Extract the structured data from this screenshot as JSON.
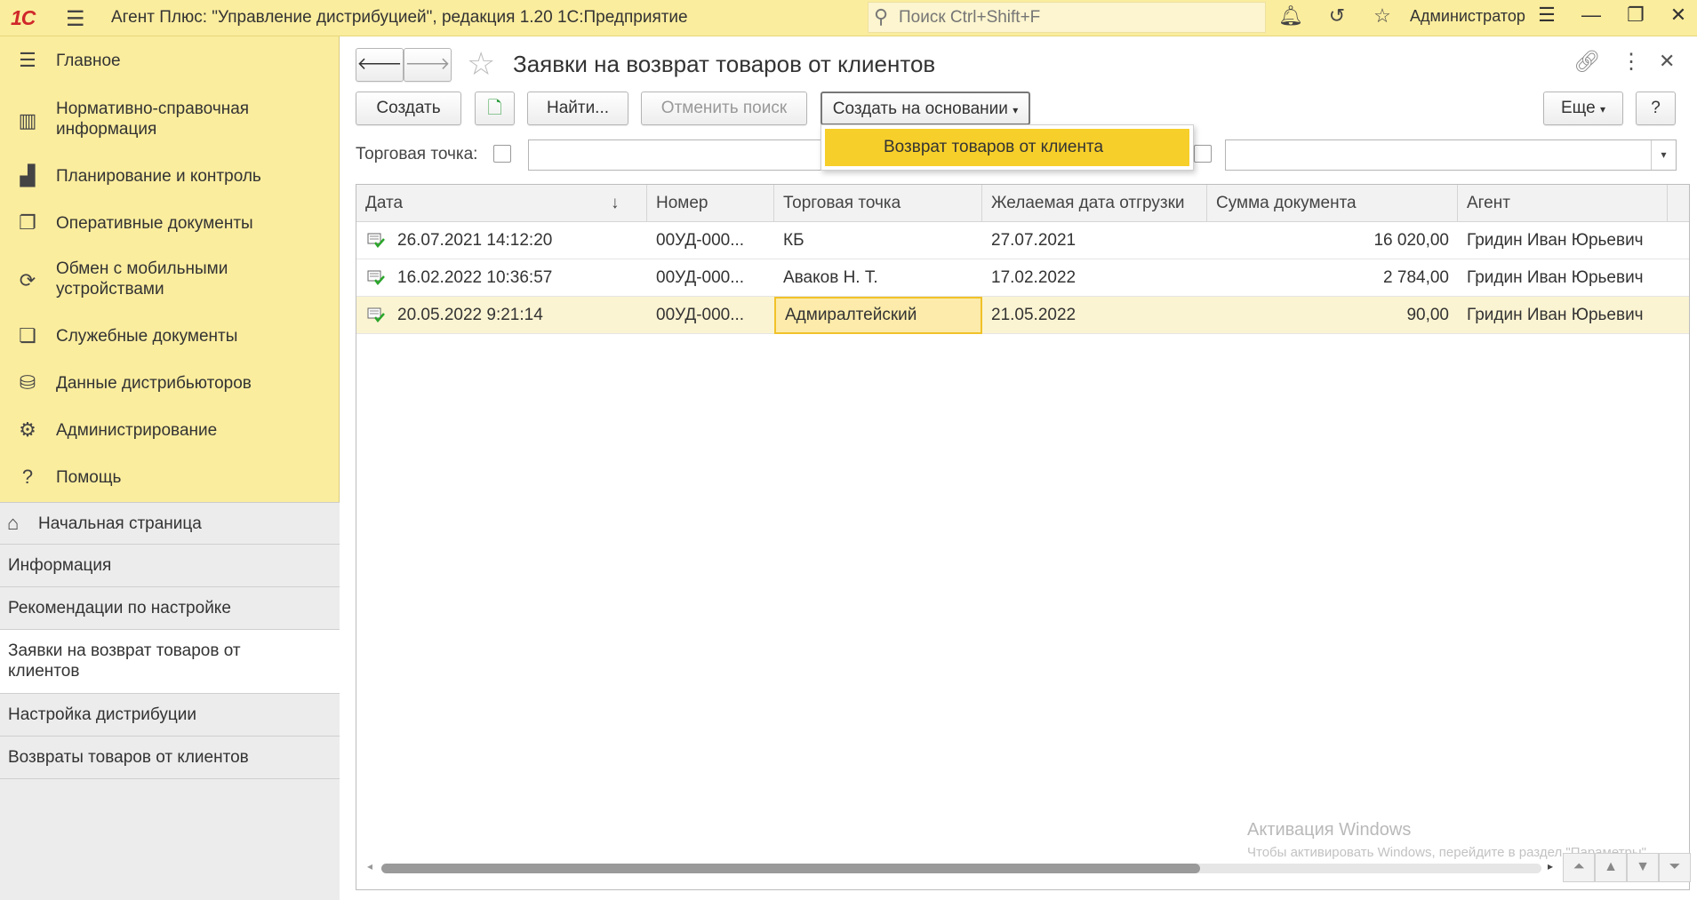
{
  "titlebar": {
    "logo": "1С",
    "title": "Агент Плюс: \"Управление дистрибуцией\", редакция 1.20 1С:Предприятие",
    "search_placeholder": "Поиск Ctrl+Shift+F",
    "user": "Администратор"
  },
  "sidebar": {
    "items": [
      {
        "label": "Главное",
        "icon": "menu-lines-icon"
      },
      {
        "label": "Нормативно-справочная информация",
        "icon": "catalog-icon"
      },
      {
        "label": "Планирование и контроль",
        "icon": "bar-chart-icon"
      },
      {
        "label": "Оперативные документы",
        "icon": "documents-icon"
      },
      {
        "label": "Обмен с мобильными устройствами",
        "icon": "sync-icon"
      },
      {
        "label": "Служебные документы",
        "icon": "service-docs-icon"
      },
      {
        "label": "Данные дистрибьюторов",
        "icon": "distributor-data-icon"
      },
      {
        "label": "Администрирование",
        "icon": "gear-icon"
      },
      {
        "label": "Помощь",
        "icon": "question-icon"
      }
    ]
  },
  "open_windows": {
    "items": [
      {
        "label": "Начальная страница"
      },
      {
        "label": "Информация"
      },
      {
        "label": "Рекомендации по настройке"
      },
      {
        "label": "Заявки на возврат товаров от клиентов"
      },
      {
        "label": "Настройка дистрибуции"
      },
      {
        "label": "Возвраты товаров от клиентов"
      }
    ]
  },
  "form": {
    "title": "Заявки на возврат товаров от клиентов",
    "buttons": {
      "create": "Создать",
      "find": "Найти...",
      "cancel_search": "Отменить поиск",
      "create_based_on": "Создать на основании",
      "more": "Еще",
      "help": "?"
    },
    "dropdown_item": "Возврат товаров от клиента",
    "filter_label": "Торговая точка:"
  },
  "table": {
    "columns": [
      "Дата",
      "Номер",
      "Торговая точка",
      "Желаемая дата отгрузки",
      "Сумма документа",
      "Агент"
    ],
    "sort_indicator": "↓",
    "rows": [
      {
        "date": "26.07.2021 14:12:20",
        "number": "00УД-000...",
        "point": "КБ",
        "ship_date": "27.07.2021",
        "sum": "16 020,00",
        "agent": "Гридин Иван Юрьевич"
      },
      {
        "date": "16.02.2022 10:36:57",
        "number": "00УД-000...",
        "point": "Аваков Н. Т.",
        "ship_date": "17.02.2022",
        "sum": "2 784,00",
        "agent": "Гридин Иван Юрьевич"
      },
      {
        "date": "20.05.2022 9:21:14",
        "number": "00УД-000...",
        "point": "Адмиралтейский",
        "ship_date": "21.05.2022",
        "sum": "90,00",
        "agent": "Гридин Иван Юрьевич"
      }
    ]
  },
  "watermark": {
    "line1": "Активация Windows",
    "line2": "Чтобы активировать Windows, перейдите в раздел \"Параметры\"."
  }
}
